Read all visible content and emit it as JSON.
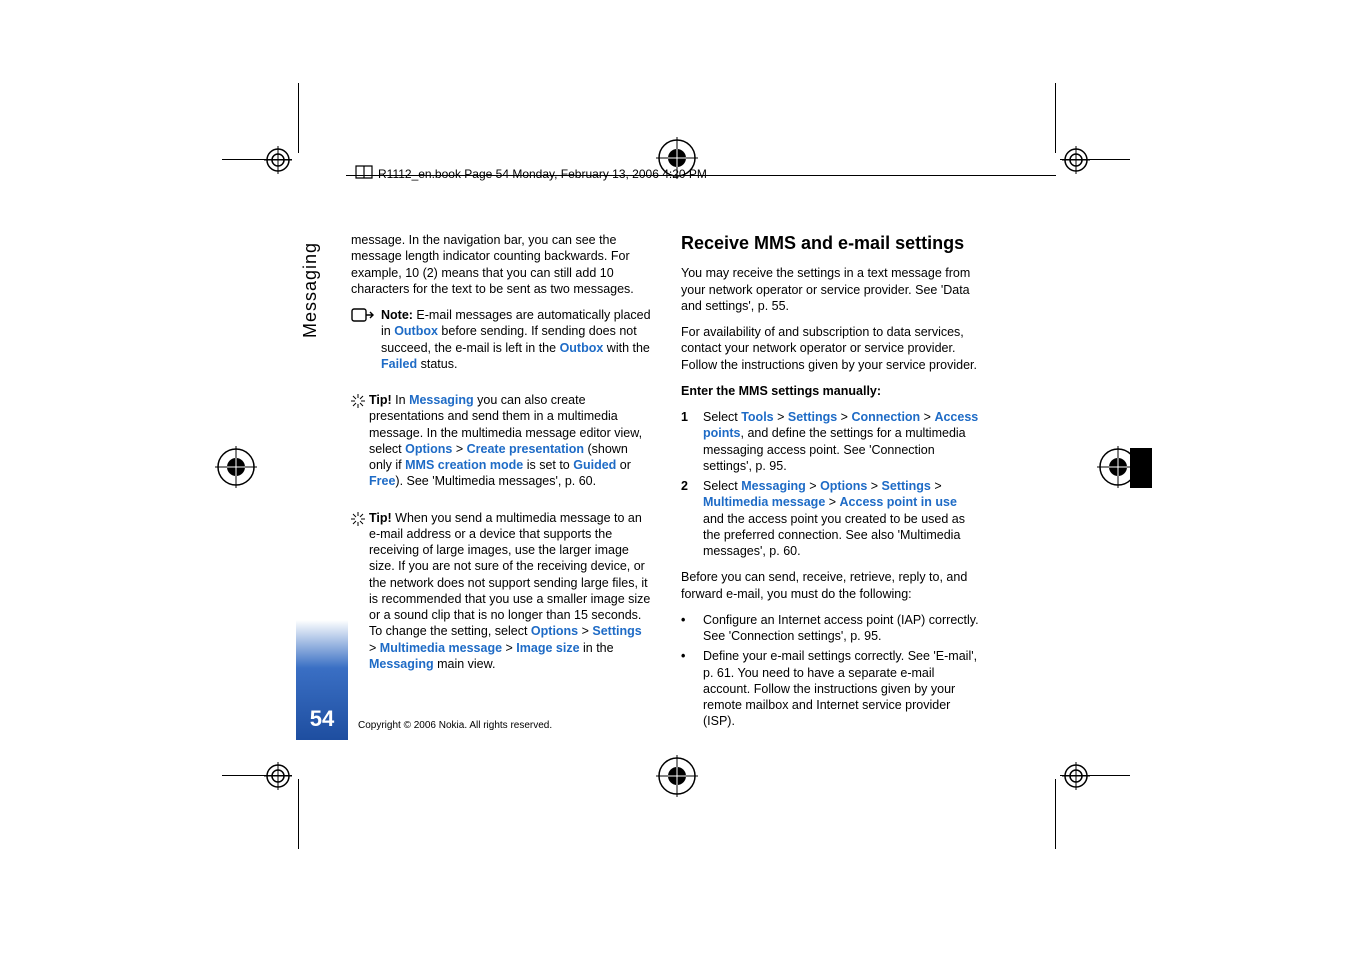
{
  "header": {
    "crop_text": "R1112_en.book  Page 54  Monday, February 13, 2006  4:20 PM"
  },
  "sidebar": {
    "section_label": "Messaging",
    "page_number": "54"
  },
  "footer": {
    "copyright": "Copyright © 2006 Nokia. All rights reserved."
  },
  "left_column": {
    "intro": "message. In the navigation bar, you can see the message length indicator counting backwards. For example, 10 (2) means that you can still add 10 characters for the text to be sent as two messages.",
    "note": {
      "label": "Note:",
      "t1": " E-mail messages are automatically placed in ",
      "l1": "Outbox",
      "t2": " before sending. If sending does not succeed, the e-mail is left in the ",
      "l2": "Outbox",
      "t3": " with the ",
      "l3": "Failed",
      "t4": " status."
    },
    "tip1": {
      "label": "Tip!",
      "t1": " In ",
      "l1": "Messaging",
      "t2": " you can also create presentations and send them in a multimedia message. In the multimedia message editor view, select ",
      "l2": "Options",
      "gt1": " > ",
      "l3": "Create presentation",
      "t3": " (shown only if ",
      "l4": "MMS creation mode",
      "t4": " is set to ",
      "l5": "Guided",
      "t5": " or ",
      "l6": "Free",
      "t6": "). See 'Multimedia messages', p. 60."
    },
    "tip2": {
      "label": "Tip!",
      "t1": " When you send a multimedia message to an e-mail address or a device that supports the receiving of large images, use the larger image size. If you are not sure of the receiving device, or the network does not support sending large files, it is recommended that you use a smaller image size or a sound clip that is no longer than 15 seconds. To change the setting, select ",
      "l1": "Options",
      "gt1": " > ",
      "l2": "Settings",
      "gt2": " > ",
      "l3": "Multimedia message",
      "gt3": " > ",
      "l4": "Image size",
      "t2": " in the ",
      "l5": "Messaging",
      "t3": " main view."
    }
  },
  "right_column": {
    "heading": "Receive MMS and e-mail settings",
    "p1": "You may receive the settings in a text message from your network operator or service provider. See 'Data and settings', p. 55.",
    "p2": "For availability of and subscription to data services, contact your network operator or service provider. Follow the instructions given by your service provider.",
    "manual_label": "Enter the MMS settings manually:",
    "step1": {
      "num": "1",
      "t1": "Select ",
      "l1": "Tools",
      "gt1": " > ",
      "l2": "Settings",
      "gt2": " > ",
      "l3": "Connection",
      "gt3": " > ",
      "l4": "Access points",
      "t2": ", and define the settings for a multimedia messaging access point. See 'Connection settings', p. 95."
    },
    "step2": {
      "num": "2",
      "t1": "Select ",
      "l1": "Messaging",
      "gt1": " > ",
      "l2": "Options",
      "gt2": " > ",
      "l3": "Settings",
      "gt3": " > ",
      "l4": "Multimedia message",
      "gt4": " > ",
      "l5": "Access point in use",
      "t2": " and the access point you created to be used as the preferred connection. See also 'Multimedia messages', p. 60."
    },
    "p3": "Before you can send, receive, retrieve, reply to, and forward e-mail, you must do the following:",
    "bullet1": "Configure an Internet access point (IAP) correctly. See 'Connection settings', p. 95.",
    "bullet2": "Define your e-mail settings correctly. See 'E-mail', p. 61. You need to have a separate e-mail account. Follow the instructions given by your remote mailbox and Internet service provider (ISP)."
  }
}
